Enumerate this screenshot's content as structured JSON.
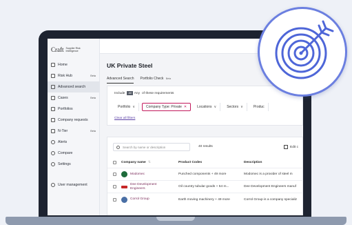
{
  "app": {
    "logo_word": "Craft",
    "logo_sub_1": "Supplier Risk",
    "logo_sub_2": "Intelligence"
  },
  "sidebar": {
    "items": [
      {
        "label": "Home",
        "icon": "home-icon",
        "badge": ""
      },
      {
        "label": "Risk Hub",
        "icon": "risk-hub-icon",
        "badge": "Beta"
      },
      {
        "label": "Advanced search",
        "icon": "advanced-search-icon",
        "badge": "",
        "active": true
      },
      {
        "label": "Cases",
        "icon": "cases-icon",
        "badge": "Beta"
      },
      {
        "label": "Portfolios",
        "icon": "portfolios-icon",
        "badge": ""
      },
      {
        "label": "Company requests",
        "icon": "company-requests-icon",
        "badge": ""
      },
      {
        "label": "N-Tier",
        "icon": "n-tier-icon",
        "badge": "Beta"
      },
      {
        "label": "Alerts",
        "icon": "bell-icon",
        "badge": ""
      },
      {
        "label": "Compare",
        "icon": "compare-icon",
        "badge": ""
      },
      {
        "label": "Settings",
        "icon": "gear-icon",
        "badge": ""
      }
    ],
    "bottom_item": {
      "label": "User management",
      "icon": "users-icon"
    }
  },
  "page": {
    "title": "UK Private Steel"
  },
  "tabs": [
    {
      "label": "Advanced Search",
      "active": true,
      "badge": ""
    },
    {
      "label": "Portfolio Check",
      "active": false,
      "badge": "Beta"
    }
  ],
  "filters": {
    "include_prefix": "Include",
    "include_mode": "All",
    "include_mode_alt": "Any",
    "include_suffix": "of these requirements",
    "chips": [
      {
        "label": "Portfolio",
        "highlighted": false
      },
      {
        "label": "Company Type: Private",
        "highlighted": true
      },
      {
        "label": "Locations",
        "highlighted": false
      },
      {
        "label": "Sectors",
        "highlighted": false
      },
      {
        "label": "Produc",
        "highlighted": false
      }
    ],
    "clear_label": "Clear all filters"
  },
  "results": {
    "search_placeholder": "Search by name or description",
    "count_label": "40 results",
    "edit_label": "Edit c",
    "columns": [
      "Company name",
      "Product Codes",
      "Description"
    ],
    "rows": [
      {
        "name_1": "Modomec",
        "name_2": "",
        "logo_color": "#1d6b3a",
        "products": "Punched components + 49 more",
        "description": "Modomec is a provider of steel m"
      },
      {
        "name_1": "Dee Development",
        "name_2": "Engineers",
        "logo_color": "#c62828",
        "products": "Oil country tubular goods + 54 m...",
        "description": "Dee Development Engineers manuf"
      },
      {
        "name_1": "Corrol Group",
        "name_2": "",
        "logo_color": "#4a6fa5",
        "products": "Earth moving machinery + 49 more",
        "description": "Corrol Group is a company specializ"
      }
    ]
  },
  "colors": {
    "accent": "#c2185b",
    "target_ring": "#6b7fe0",
    "target_inner": "#4e66d8"
  },
  "icons": {
    "target": "target-arrow-icon"
  }
}
